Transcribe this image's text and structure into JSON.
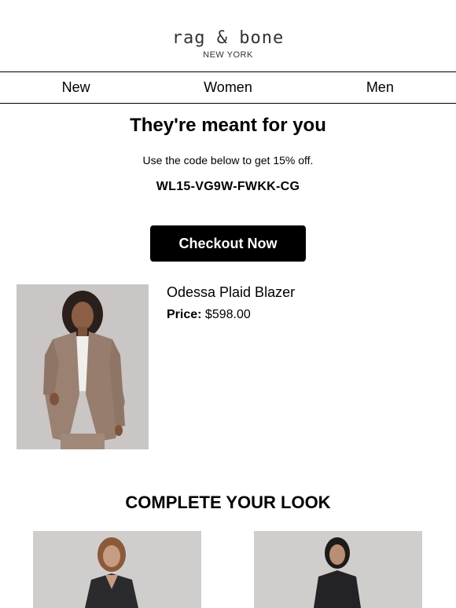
{
  "brand": {
    "name": "rag & bone",
    "sub": "NEW YORK"
  },
  "nav": {
    "items": [
      "New",
      "Women",
      "Men"
    ]
  },
  "hero": {
    "headline": "They're meant for you",
    "subtext": "Use the code below to get 15% off.",
    "code": "WL15-VG9W-FWKK-CG",
    "cta": "Checkout Now"
  },
  "product": {
    "name": "Odessa Plaid Blazer",
    "price_label": "Price:",
    "price_value": "$598.00"
  },
  "look": {
    "title": "COMPLETE YOUR LOOK"
  },
  "colors": {
    "button_bg": "#000000",
    "button_text": "#ffffff",
    "image_bg": "#c8c5c4"
  }
}
